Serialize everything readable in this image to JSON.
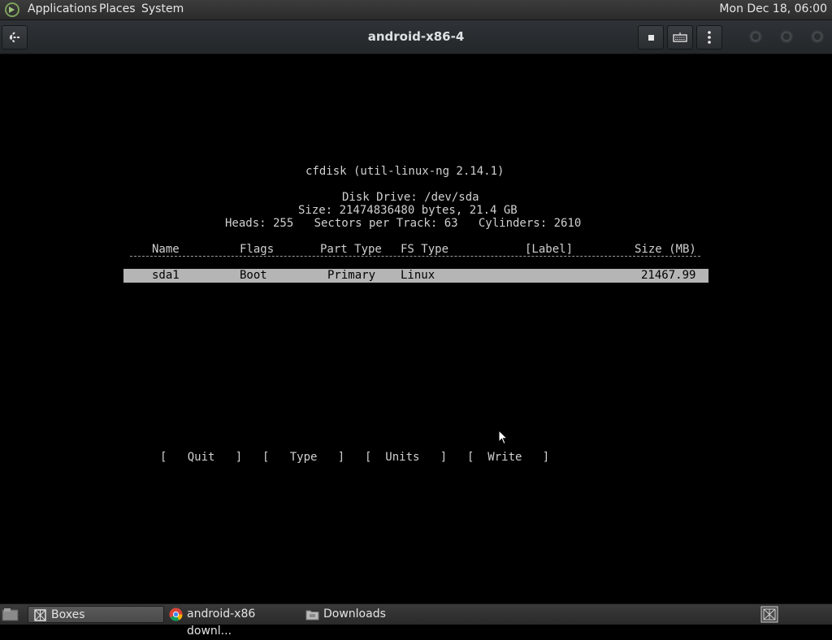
{
  "top_panel": {
    "menus": [
      "Applications",
      "Places",
      "System"
    ],
    "clock": "Mon Dec 18, 06:00"
  },
  "header": {
    "title": "android-x86-4"
  },
  "terminal": {
    "program": "cfdisk (util-linux-ng 2.14.1)",
    "disk_drive": "Disk Drive: /dev/sda",
    "size": "Size: 21474836480 bytes, 21.4 GB",
    "geometry": "Heads: 255   Sectors per Track: 63   Cylinders: 2610",
    "columns": [
      "Name",
      "Flags",
      "Part Type",
      "FS Type",
      "[Label]",
      "Size (MB)"
    ],
    "partitions": [
      {
        "name": "sda1",
        "flags": "Boot",
        "part_type": "Primary",
        "fs_type": "Linux",
        "label": "",
        "size": "21467.99"
      }
    ],
    "actions": [
      "Quit",
      "Type",
      "Units",
      "Write"
    ]
  },
  "taskbar": {
    "tasks": [
      {
        "label": "Boxes",
        "active": true
      },
      {
        "label": "android-x86 downl...",
        "active": false
      },
      {
        "label": "Downloads",
        "active": false
      }
    ]
  }
}
